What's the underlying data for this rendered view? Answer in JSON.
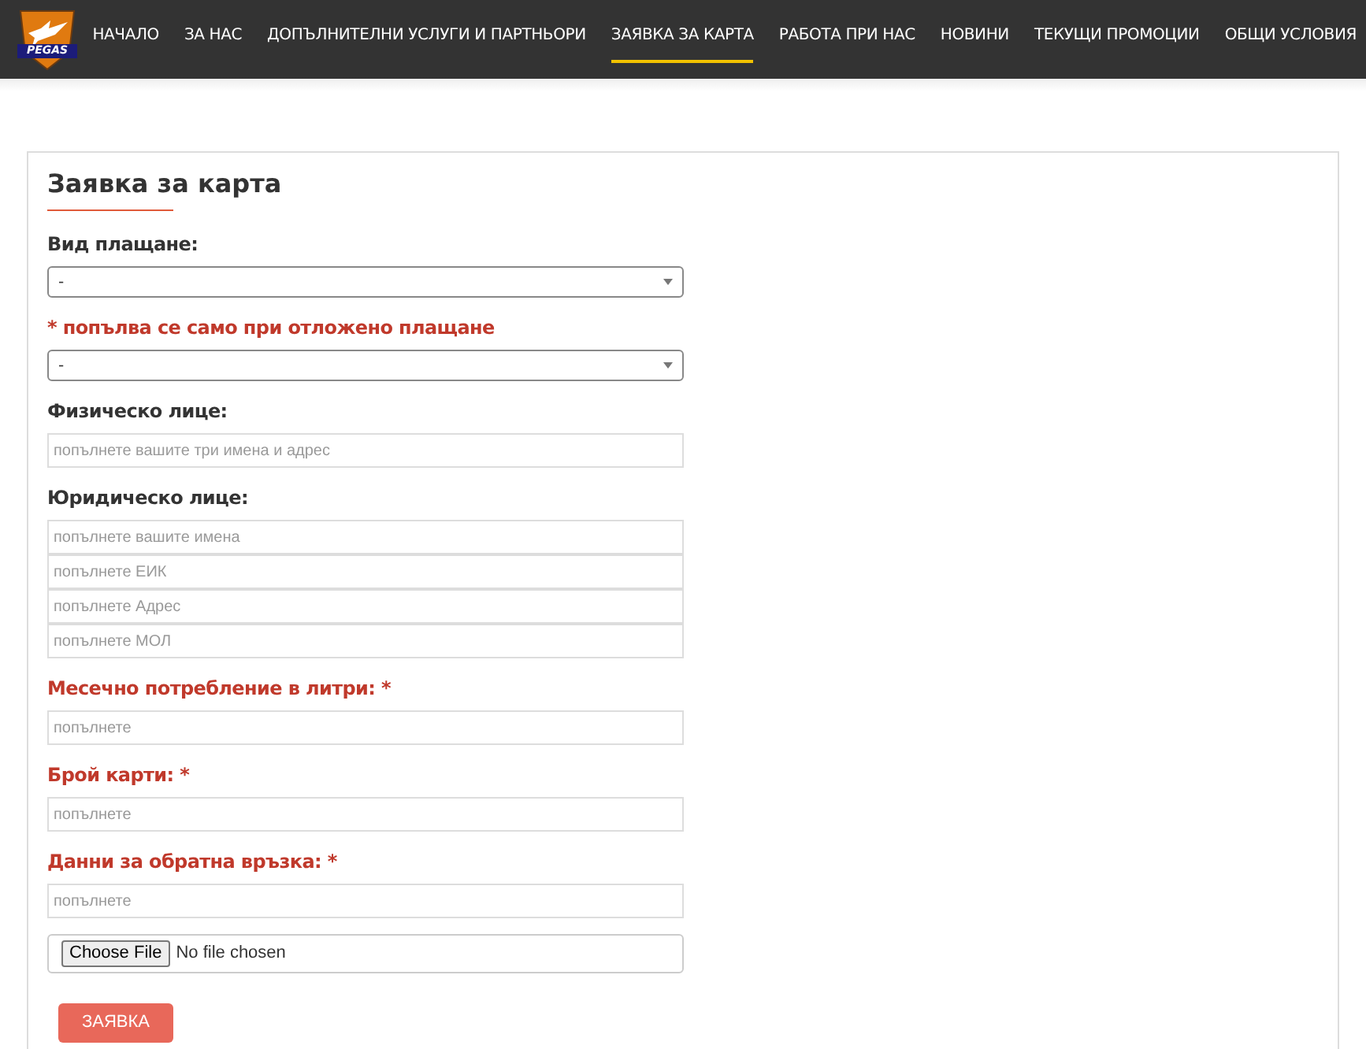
{
  "logo": {
    "text": "PEGAS"
  },
  "nav": [
    {
      "label": "НАЧАЛО",
      "selected": false
    },
    {
      "label": "ЗА НАС",
      "selected": false
    },
    {
      "label": "ДОПЪЛНИТЕЛНИ УСЛУГИ И ПАРТНЬОРИ",
      "selected": false
    },
    {
      "label": "ЗАЯВКА ЗА КАРТА",
      "selected": true
    },
    {
      "label": "РАБОТА ПРИ НАС",
      "selected": false
    },
    {
      "label": "НОВИНИ",
      "selected": false
    },
    {
      "label": "ТЕКУЩИ ПРОМОЦИИ",
      "selected": false
    },
    {
      "label": "ОБЩИ УСЛОВИЯ",
      "selected": false
    }
  ],
  "form": {
    "title": "Заявка за карта",
    "groups": [
      {
        "label": "Вид плащане:",
        "required": false,
        "fields": [
          {
            "kind": "select",
            "value": "-"
          }
        ]
      },
      {
        "label": "* попълва се само при отложено плащане",
        "required": true,
        "fields": [
          {
            "kind": "select",
            "value": "-"
          }
        ]
      },
      {
        "label": "Физическо лице:",
        "required": false,
        "fields": [
          {
            "kind": "text",
            "placeholder": "попълнете вашите три имена и адрес"
          }
        ]
      },
      {
        "label": "Юридическо лице:",
        "required": false,
        "fields": [
          {
            "kind": "text",
            "placeholder": "попълнете вашите имена"
          },
          {
            "kind": "text",
            "placeholder": "попълнете ЕИК"
          },
          {
            "kind": "text",
            "placeholder": "попълнете Адрес"
          },
          {
            "kind": "text",
            "placeholder": "попълнете МОЛ"
          }
        ]
      },
      {
        "label": "Месечно потребление в литри: *",
        "required": true,
        "fields": [
          {
            "kind": "text",
            "placeholder": "попълнете"
          }
        ]
      },
      {
        "label": "Брой карти: *",
        "required": true,
        "fields": [
          {
            "kind": "text",
            "placeholder": "попълнете"
          }
        ]
      },
      {
        "label": "Данни за обратна връзка: *",
        "required": true,
        "fields": [
          {
            "kind": "text",
            "placeholder": "попълнете"
          }
        ]
      },
      {
        "fields": [
          {
            "kind": "file",
            "button": "Choose File",
            "status": "No file chosen"
          }
        ]
      }
    ],
    "submit": "ЗАЯВКА"
  }
}
